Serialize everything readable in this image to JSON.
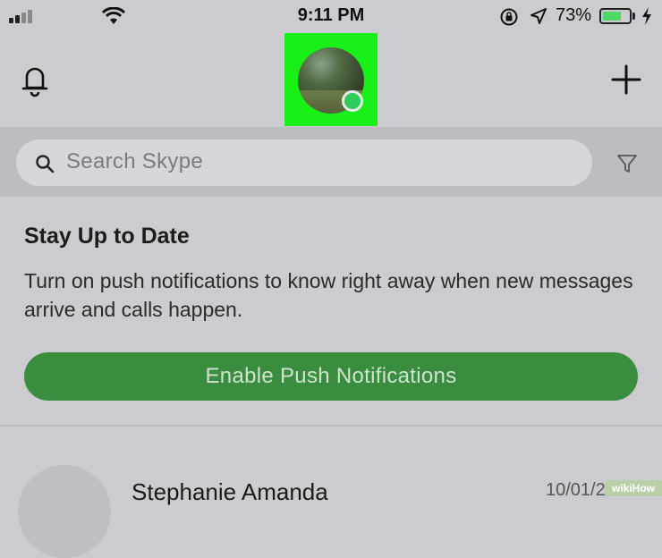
{
  "status_bar": {
    "time": "9:11 PM",
    "battery_percent": "73%",
    "battery_level": 0.73,
    "signal_bars": 2,
    "icons": [
      "signal-icon",
      "wifi-icon",
      "rotation-lock-icon",
      "location-icon",
      "battery-icon",
      "charging-icon"
    ]
  },
  "header": {
    "left_icon": "bell-icon",
    "right_icon": "plus-icon",
    "avatar_status_color": "#2ecc5a",
    "highlight_color": "#18f018"
  },
  "search": {
    "placeholder": "Search Skype",
    "filter_icon": "filter-icon"
  },
  "notification_card": {
    "title": "Stay Up to Date",
    "body": "Turn on push notifications to know right away when new messages arrive and calls happen.",
    "button_label": "Enable Push Notifications",
    "button_color": "#3a8d3f"
  },
  "conversations": [
    {
      "name": "Stephanie Amanda",
      "date": "10/01/2"
    }
  ],
  "watermark": "wikiHow"
}
